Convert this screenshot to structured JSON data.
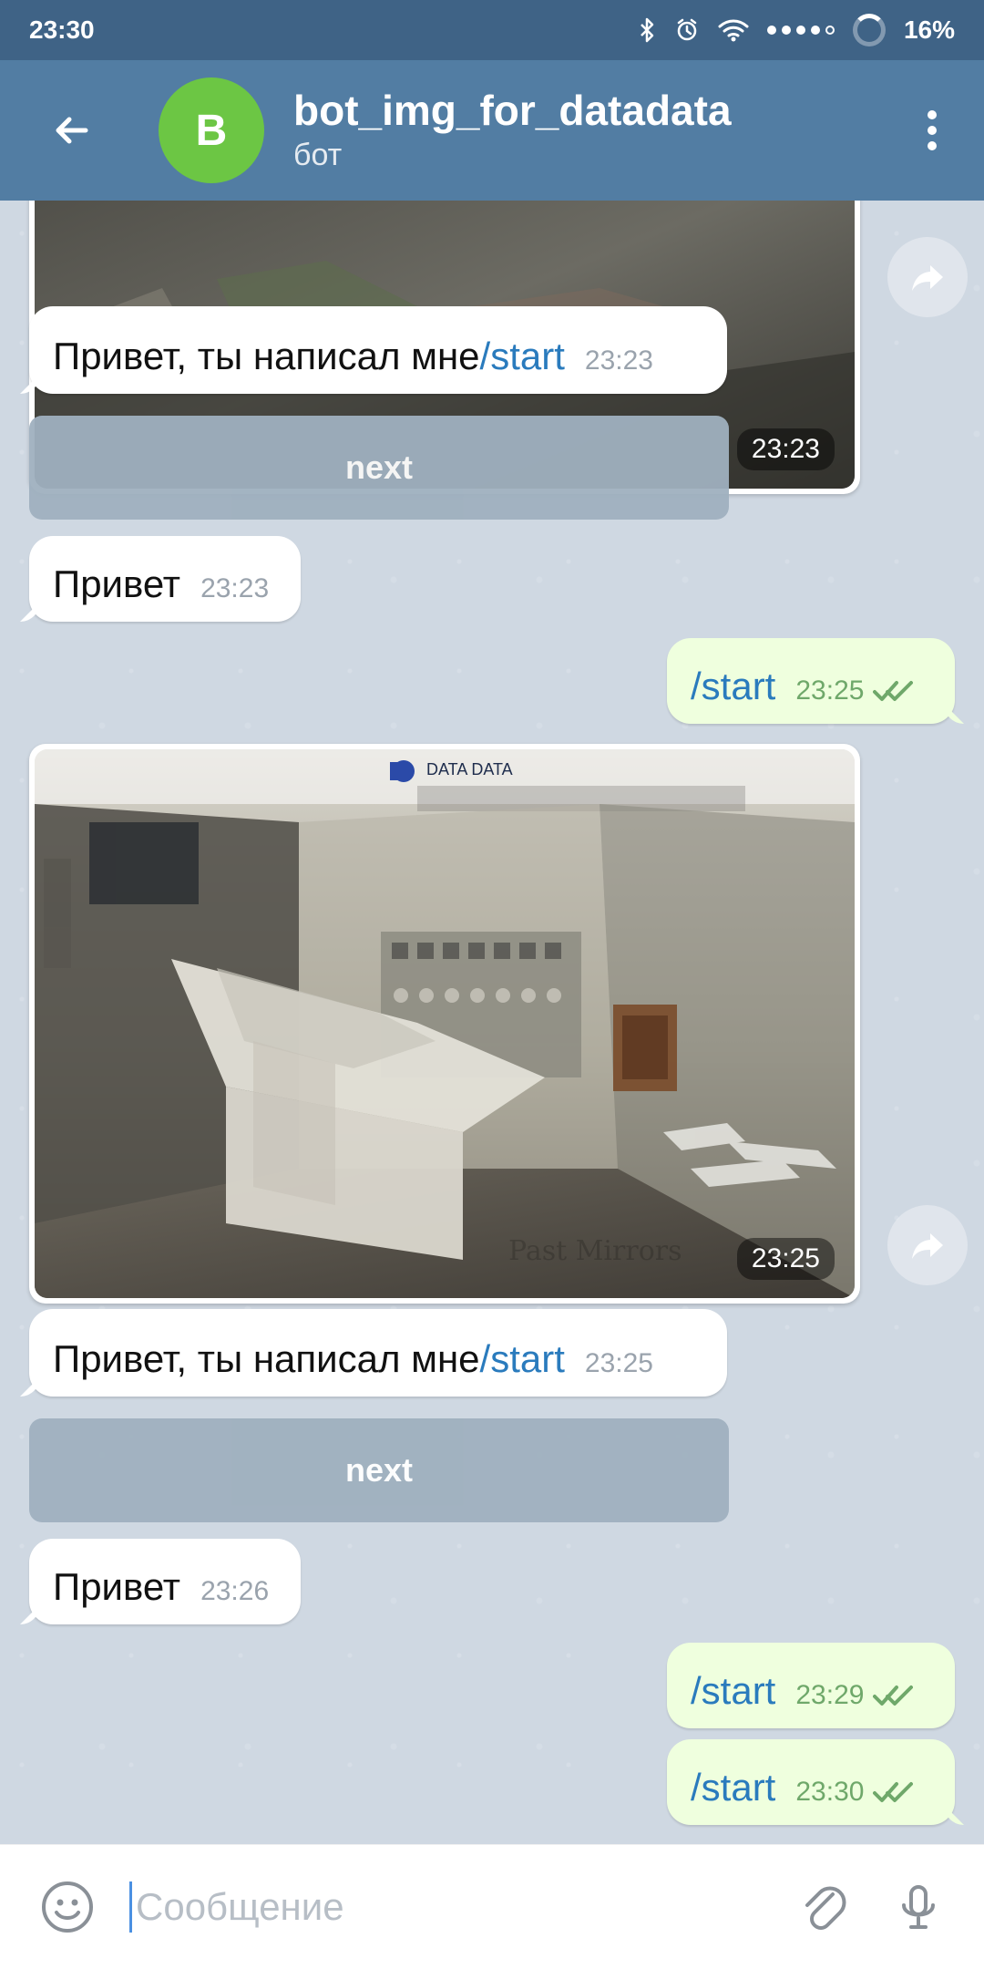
{
  "status_bar": {
    "time": "23:30",
    "battery": "16%",
    "icons": [
      "bluetooth-icon",
      "alarm-icon",
      "wifi-icon",
      "signal-dots-icon",
      "battery-ring-icon"
    ]
  },
  "header": {
    "back_icon": "back-arrow-icon",
    "avatar_letter": "B",
    "title": "bot_img_for_datadata",
    "subtitle": "бот",
    "menu_icon": "more-vert-icon"
  },
  "messages": [
    {
      "type": "photo",
      "time": "23:23",
      "share_icon": "share-forward-icon"
    },
    {
      "type": "text_in",
      "text": "Привет, ты написал мне ",
      "link": "/start",
      "time": "23:23"
    },
    {
      "type": "keyboard_button",
      "label": "next"
    },
    {
      "type": "text_in",
      "text": "Привет",
      "time": "23:23"
    },
    {
      "type": "text_out",
      "text": "/start",
      "time": "23:25",
      "status": "read"
    },
    {
      "type": "photo",
      "time": "23:25",
      "watermark": "DATA DATA",
      "share_icon": "share-forward-icon"
    },
    {
      "type": "text_in",
      "text": "Привет, ты написал мне ",
      "link": "/start",
      "time": "23:25"
    },
    {
      "type": "keyboard_button",
      "label": "next"
    },
    {
      "type": "text_in",
      "text": "Привет",
      "time": "23:26"
    },
    {
      "type": "text_out",
      "text": "/start",
      "time": "23:29",
      "status": "read"
    },
    {
      "type": "text_out",
      "text": "/start",
      "time": "23:30",
      "status": "read"
    }
  ],
  "composer": {
    "placeholder": "Сообщение",
    "emoji_icon": "emoji-icon",
    "attach_icon": "paperclip-icon",
    "mic_icon": "microphone-icon"
  },
  "colors": {
    "status_bar": "#3f6386",
    "header": "#527da3",
    "chat_background": "#cfd8e2",
    "incoming_bubble": "#ffffff",
    "outgoing_bubble": "#efffde",
    "link": "#2a7bbd",
    "avatar": "#6cc644"
  }
}
